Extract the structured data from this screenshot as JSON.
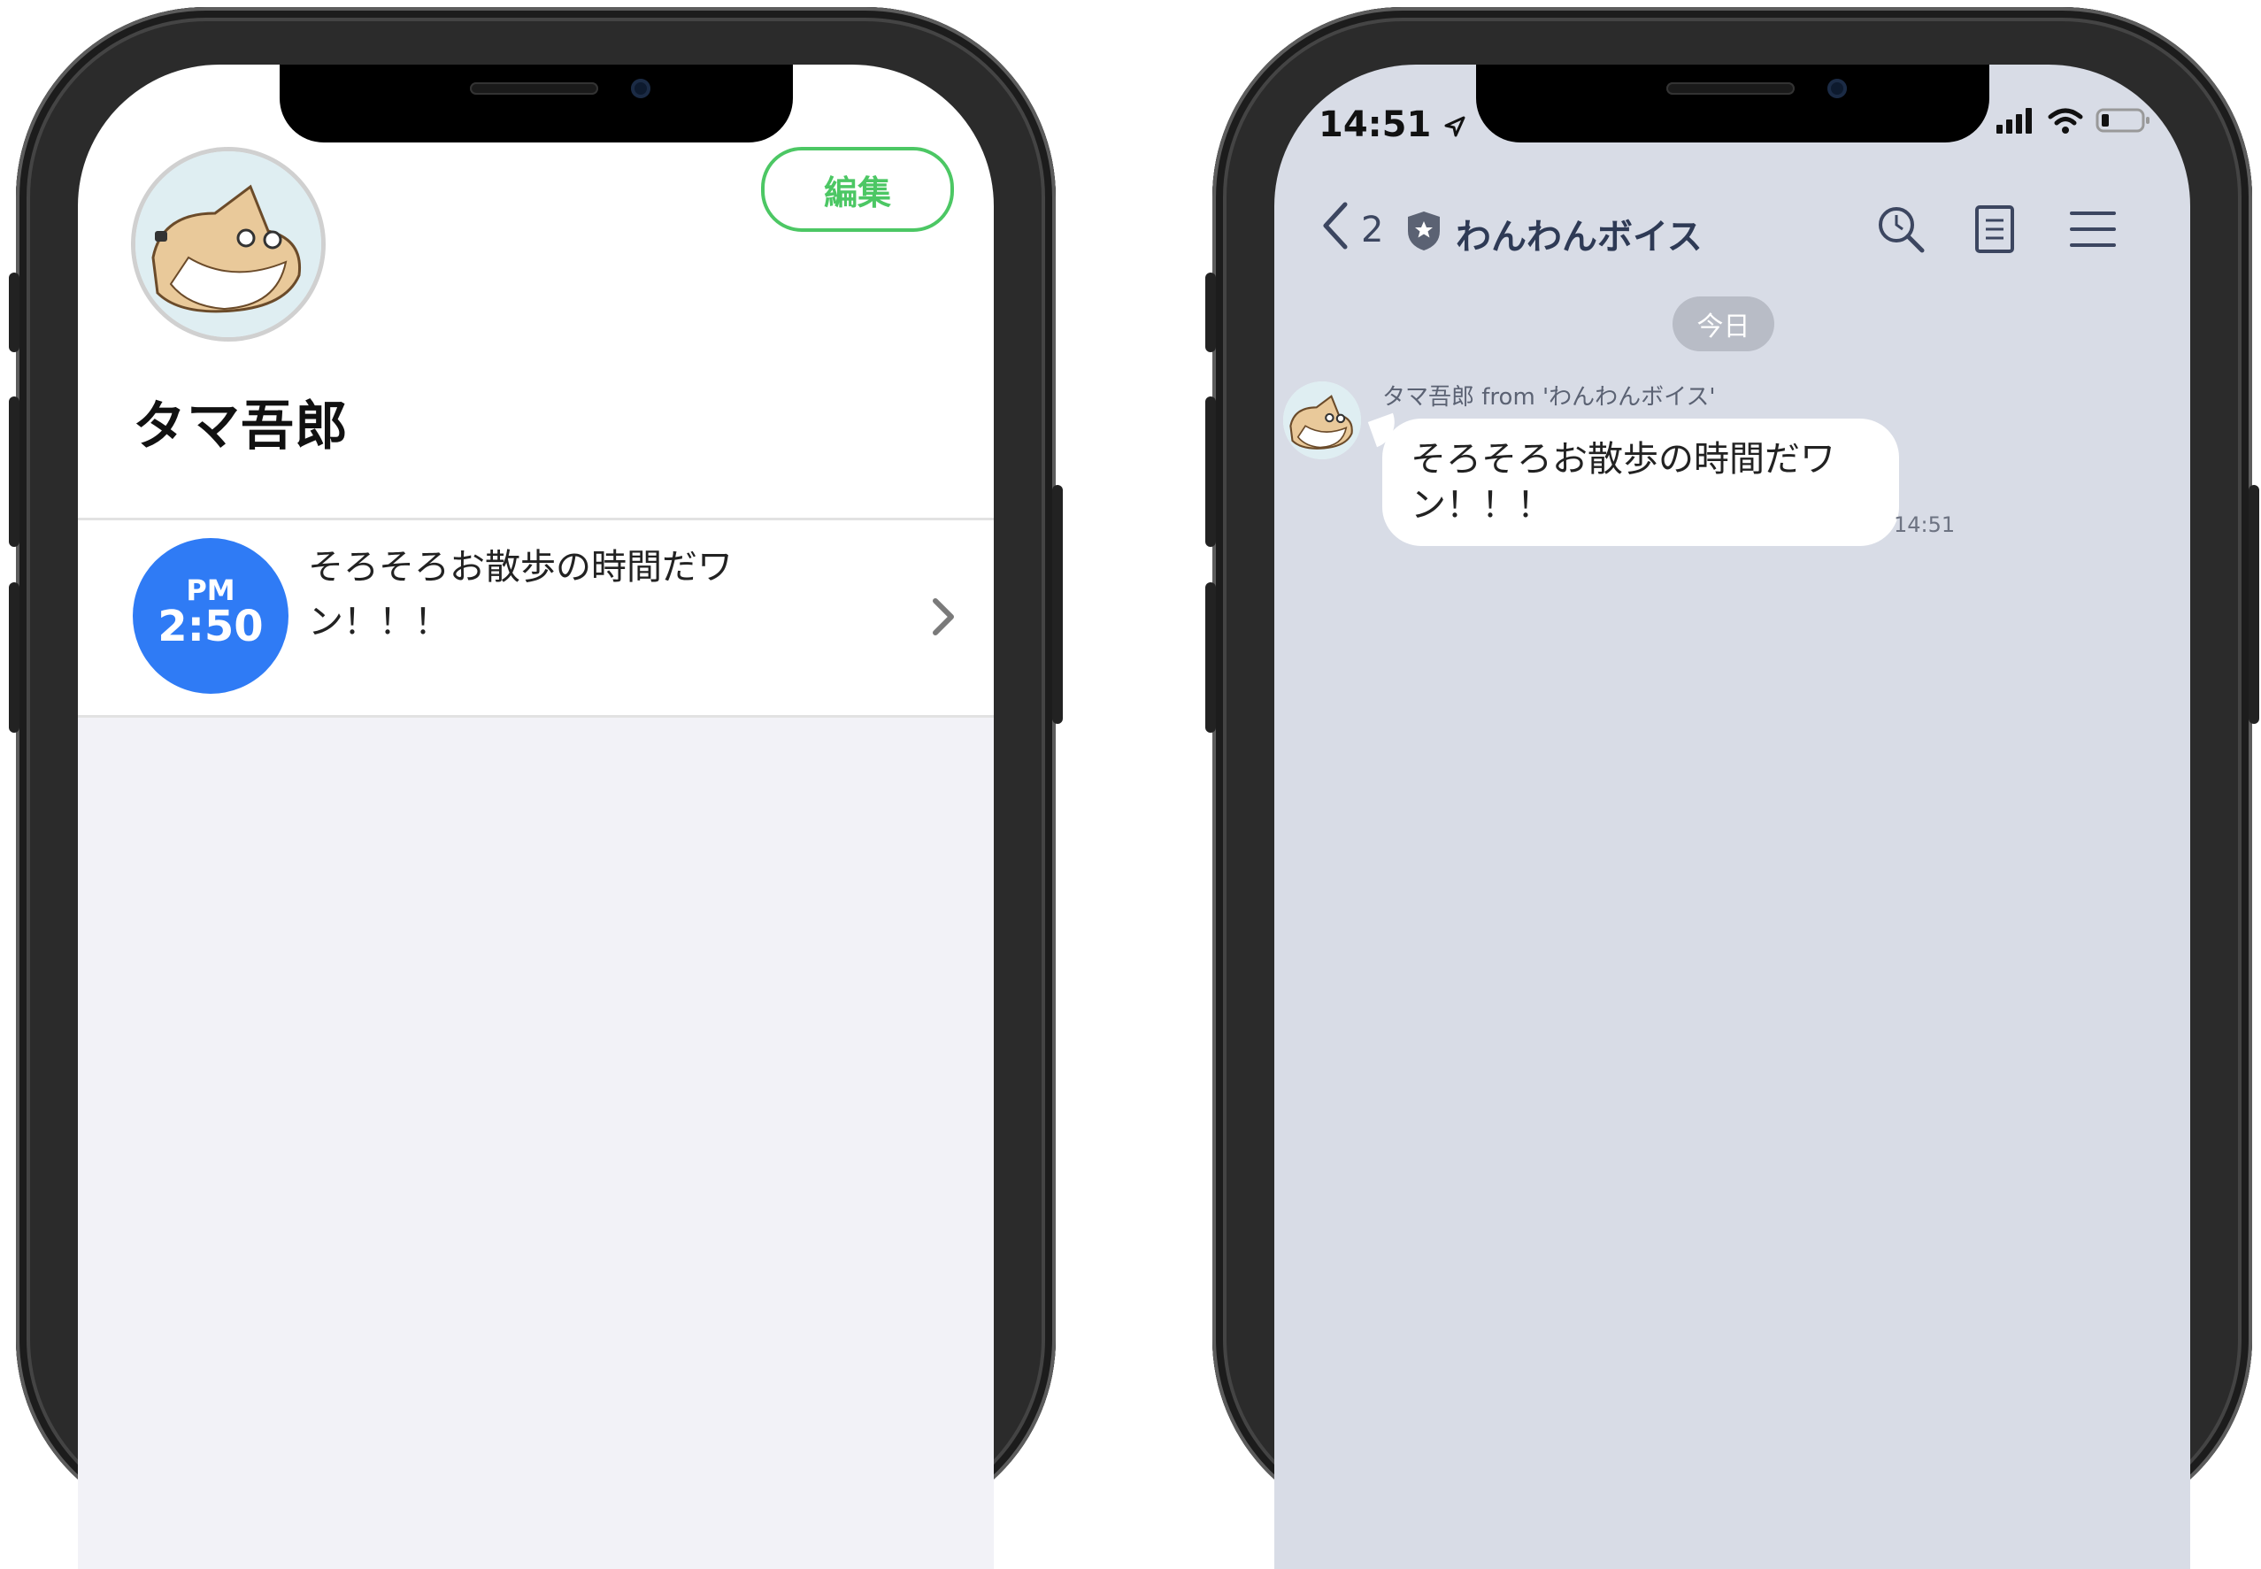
{
  "left_phone": {
    "edit_button": "編集",
    "profile_name": "タマ吾郎",
    "reminder": {
      "ampm": "PM",
      "time": "2:50",
      "text": "そろそろお散歩の時間だワン！！！"
    },
    "colors": {
      "accent_green": "#4cc764",
      "badge_blue": "#2f7bf5",
      "list_bg": "#f2f2f7"
    },
    "icons": [
      "dog-avatar",
      "chevron-right-icon"
    ]
  },
  "right_phone": {
    "status_bar": {
      "time": "14:51"
    },
    "nav": {
      "back_count": "2",
      "chat_title": "わんわんボイス"
    },
    "date_separator": "今日",
    "message": {
      "sender": "タマ吾郎 from 'わんわんボイス'",
      "text": "そろそろお散歩の時間だワン！！！",
      "time": "14:51"
    },
    "colors": {
      "chat_bg": "#d8dce6",
      "title_color": "#2e3a55"
    },
    "icons": [
      "location-arrow-icon",
      "signal-icon",
      "wifi-icon",
      "battery-icon",
      "back-chevron-icon",
      "shield-star-icon",
      "search-icon",
      "notes-icon",
      "menu-icon"
    ]
  }
}
